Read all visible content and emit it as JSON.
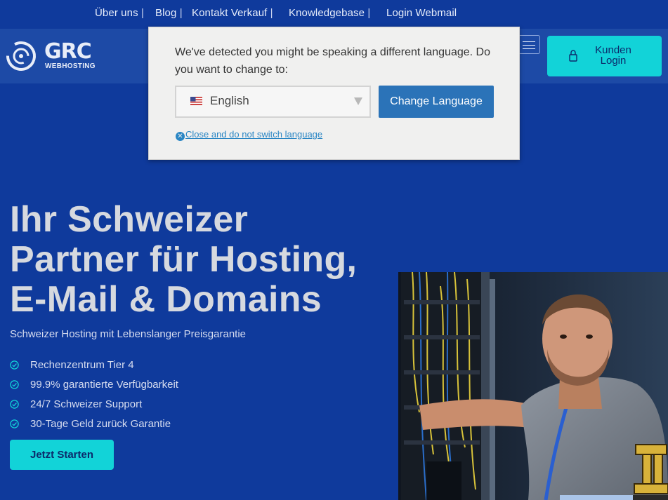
{
  "top_nav": {
    "items": [
      {
        "label": "Über uns",
        "sep": " |"
      },
      {
        "label": "Blog",
        "sep": " |"
      },
      {
        "label": "Kontakt Verkauf",
        "sep": " |"
      },
      {
        "label": "Knowledgebase",
        "sep": " |"
      },
      {
        "label": "Login Webmail",
        "sep": ""
      }
    ]
  },
  "header": {
    "logo_main": "GRC",
    "logo_sub": "WEBHOSTING",
    "login_label_line1": "Kunden",
    "login_label_line2": "Login"
  },
  "language_popup": {
    "message": "We've detected you might be speaking a different language. Do you want to change to:",
    "selected_language": "English",
    "change_button": "Change Language",
    "close_link": "Close and do not switch language"
  },
  "hero": {
    "title_lines": [
      "Ihr Schweizer",
      "Partner für Hosting,",
      "E-Mail & Domains"
    ],
    "subtitle": "Schweizer Hosting mit Lebenslanger Preisgarantie",
    "features": [
      "Rechenzentrum Tier 4",
      "99.9% garantierte Verfügbarkeit",
      "24/7 Schweizer Support",
      "30-Tage Geld zurück Garantie"
    ],
    "cta": "Jetzt Starten"
  },
  "colors": {
    "background": "#0f3a9c",
    "header_band": "#1d4aa6",
    "accent_cyan": "#12d3d8",
    "popup_button": "#2b73b8",
    "link_blue": "#2a86c4"
  }
}
